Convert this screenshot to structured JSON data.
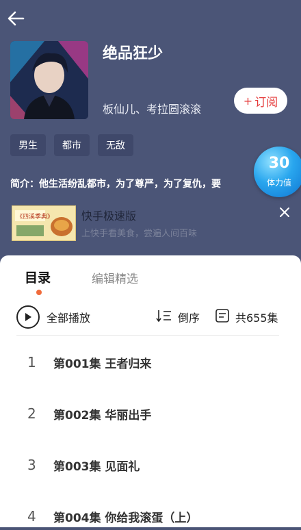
{
  "header": {
    "title": "绝品狂少",
    "authors": "板仙儿、考拉圆滚滚",
    "subscribe_label": "订阅",
    "tags": [
      "男生",
      "都市",
      "无敌"
    ],
    "intro": "简介：他生活纷乱都市，为了尊严，为了复仇，要"
  },
  "stamina": {
    "value": "30",
    "label": "体力值"
  },
  "ad": {
    "title": "快手极速版",
    "subtitle": "上快手看美食，尝遍人间百味",
    "thumb_text": "《四溪季典》"
  },
  "sheet": {
    "tabs": [
      "目录",
      "编辑精选"
    ],
    "play_all": "全部播放",
    "order_label": "倒序",
    "count_label": "共655集",
    "episodes": [
      {
        "num": "1",
        "title": "第001集 王者归来"
      },
      {
        "num": "2",
        "title": "第002集 华丽出手"
      },
      {
        "num": "3",
        "title": "第003集 见面礼"
      },
      {
        "num": "4",
        "title": "第004集 你给我滚蛋（上）"
      }
    ]
  },
  "colors": {
    "header_bg": "#4b5577",
    "accent_red": "#e53b3b",
    "tab_dot": "#f06b3b",
    "stamina_blue": "#29a6ee"
  }
}
